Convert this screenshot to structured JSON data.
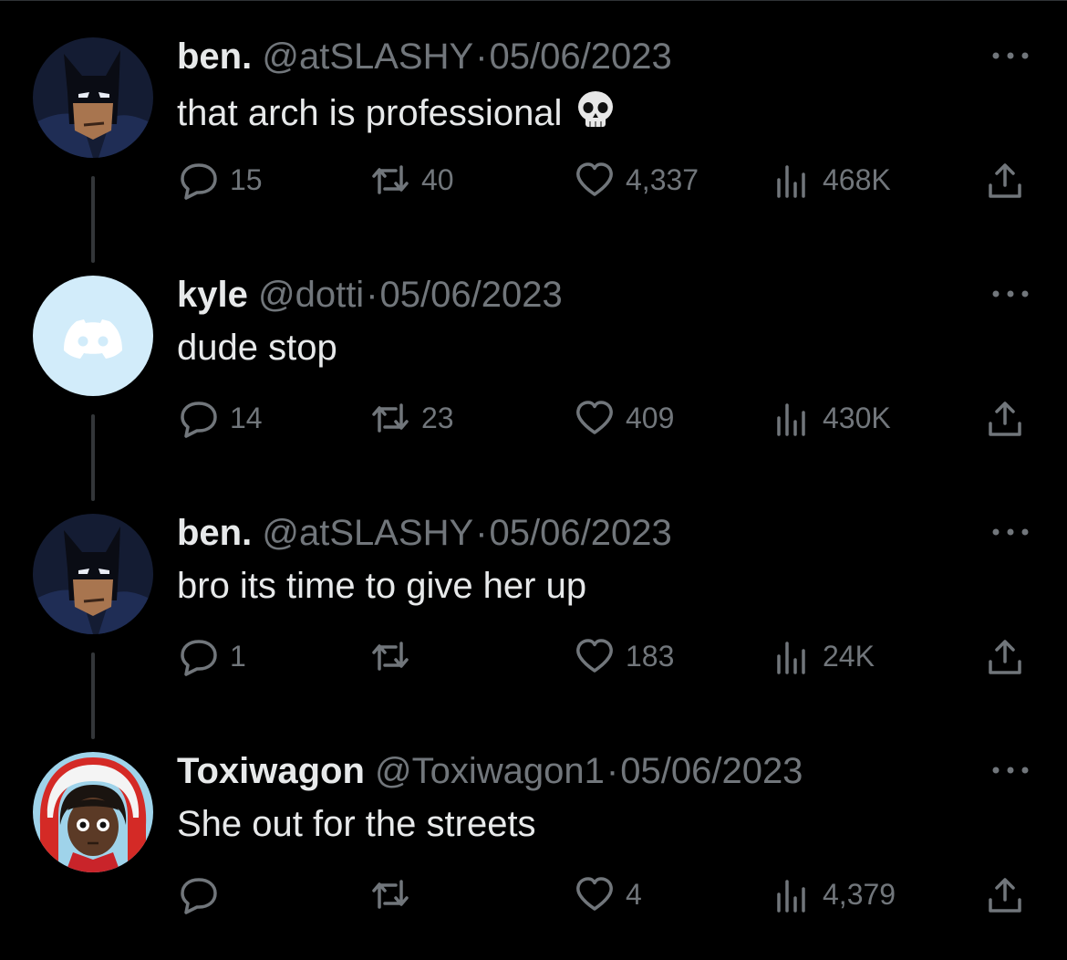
{
  "colors": {
    "background": "#000000",
    "text": "#e7e9ea",
    "secondary": "#71767b",
    "thread_line": "#333639"
  },
  "tweets": [
    {
      "avatar": "batman-avatar",
      "name": "ben.",
      "handle": "@atSLASHY",
      "dot": "·",
      "date": "05/06/2023",
      "text": "that arch is professional",
      "emoji": "skull-emoji",
      "replies": "15",
      "retweets": "40",
      "likes": "4,337",
      "views": "468K"
    },
    {
      "avatar": "discord-avatar",
      "name": "kyle",
      "handle": "@dotti",
      "dot": "·",
      "date": "05/06/2023",
      "text": "dude stop",
      "replies": "14",
      "retweets": "23",
      "likes": "409",
      "views": "430K"
    },
    {
      "avatar": "batman-avatar",
      "name": "ben.",
      "handle": "@atSLASHY",
      "dot": "·",
      "date": "05/06/2023",
      "text": "bro its time to give her up",
      "replies": "1",
      "retweets": "",
      "likes": "183",
      "views": "24K"
    },
    {
      "avatar": "anime-avatar",
      "name": "Toxiwagon",
      "handle": "@Toxiwagon1",
      "dot": "·",
      "date": "05/06/2023",
      "text": "She out for the streets",
      "replies": "",
      "retweets": "",
      "likes": "4",
      "views": "4,379"
    }
  ]
}
